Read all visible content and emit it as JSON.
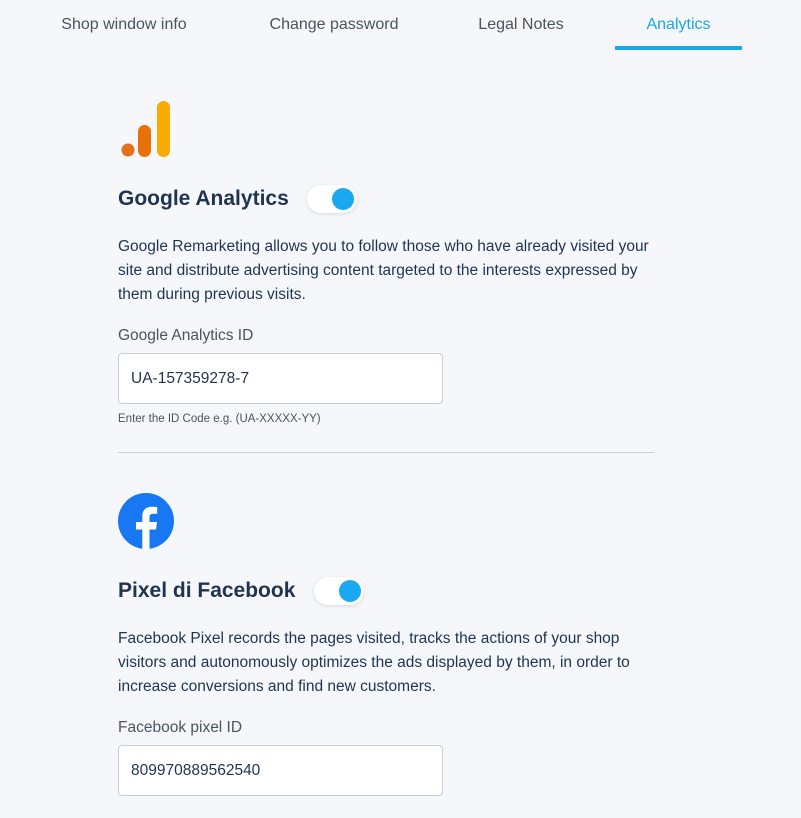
{
  "tabs": [
    {
      "label": "Shop window info",
      "active": false
    },
    {
      "label": "Change password",
      "active": false
    },
    {
      "label": "Legal Notes",
      "active": false
    },
    {
      "label": "Analytics",
      "active": true
    }
  ],
  "colors": {
    "accent": "#19a7e6",
    "toggle_knob": "#1aa9f0",
    "ga_orange_dark": "#e3711b",
    "ga_orange_light": "#f9ab00",
    "facebook_blue": "#1877f2"
  },
  "google_analytics": {
    "icon": "google-analytics-logo-icon",
    "title": "Google Analytics",
    "enabled": true,
    "description": "Google Remarketing allows you to follow those who have already visited your site and distribute advertising content targeted to the interests expressed by them during previous visits.",
    "id_label": "Google Analytics ID",
    "id_value": "UA-157359278-7",
    "hint": "Enter the ID Code e.g. (UA-XXXXX-YY)"
  },
  "facebook_pixel": {
    "icon": "facebook-logo-icon",
    "title": "Pixel di Facebook",
    "enabled": true,
    "description": "Facebook Pixel records the pages visited, tracks the actions of your shop visitors and autonomously optimizes the ads displayed by them, in order to increase conversions and find new customers.",
    "id_label": "Facebook pixel ID",
    "id_value": "809970889562540"
  }
}
